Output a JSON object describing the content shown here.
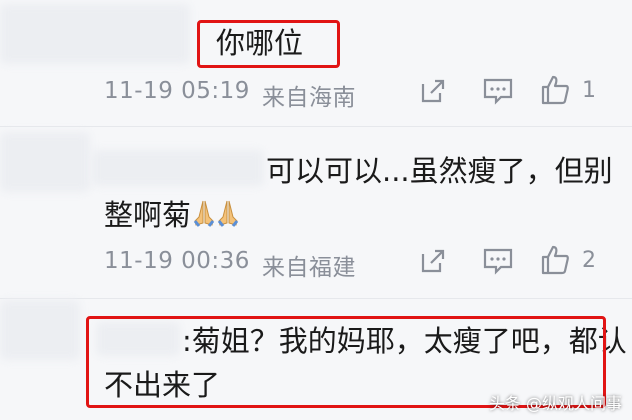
{
  "comments": [
    {
      "text": "你哪位",
      "time": "11-19 05:19",
      "location": "来自海南",
      "likes": "1"
    },
    {
      "text_line1": "可以可以...虽然瘦了，但别",
      "text_line2": "整啊菊",
      "time": "11-19 00:36",
      "location": "来自福建",
      "likes": "2"
    },
    {
      "text_line1": ":菊姐？我的妈耶，太瘦了吧，都认",
      "text_line2": "不出来了"
    }
  ],
  "watermark": "头条 @纵观人间事",
  "colors": {
    "highlight": "#e11414",
    "meta": "#8a8f99",
    "background": "#f6f7f9"
  },
  "icons": [
    "share-icon",
    "comment-icon",
    "like-icon",
    "pray-emoji"
  ]
}
